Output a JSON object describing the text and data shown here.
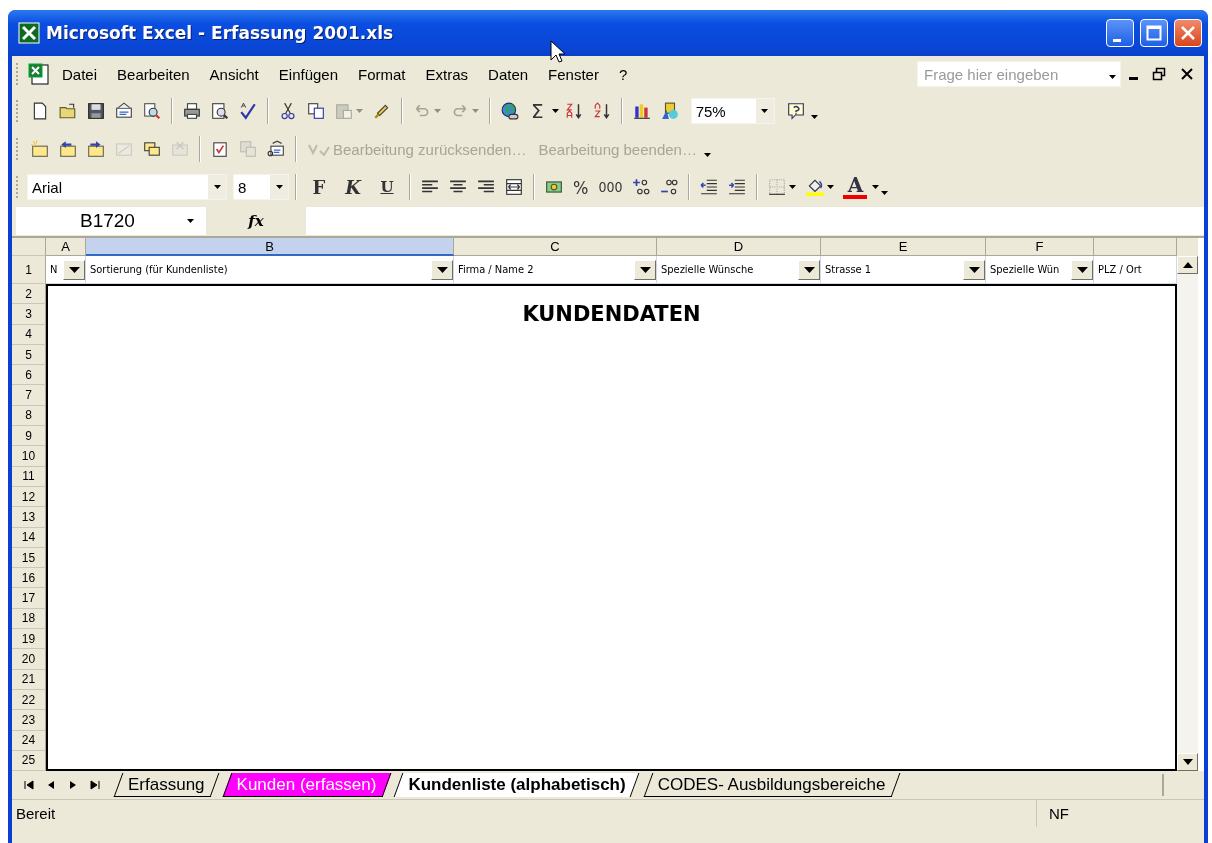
{
  "window": {
    "title": "Microsoft Excel - Erfassung 2001.xls"
  },
  "menu": [
    {
      "label": "Datei"
    },
    {
      "label": "Bearbeiten"
    },
    {
      "label": "Ansicht"
    },
    {
      "label": "Einfügen"
    },
    {
      "label": "Format"
    },
    {
      "label": "Extras"
    },
    {
      "label": "Daten"
    },
    {
      "label": "Fenster"
    },
    {
      "label": "?"
    }
  ],
  "help_search": {
    "placeholder": "Frage hier eingeben"
  },
  "standard_toolbar": {
    "sum": "Σ",
    "zoom": "75%",
    "items": [
      {
        "disabled": false
      },
      {
        "disabled": false
      },
      {
        "disabled": false
      },
      {
        "disabled": false
      },
      {
        "disabled": false
      },
      {
        "disabled": false
      },
      {
        "disabled": false
      },
      {
        "disabled": false
      },
      {
        "disabled": false
      },
      {
        "disabled": false
      },
      {
        "disabled": true
      },
      {
        "disabled": false
      },
      {
        "disabled": true
      },
      {
        "disabled": true
      },
      {
        "disabled": false
      },
      {
        "disabled": false
      },
      {
        "disabled": false
      },
      {
        "disabled": false
      },
      {
        "disabled": false
      },
      {
        "disabled": false
      }
    ]
  },
  "review_toolbar": {
    "items": [
      {
        "disabled": false
      },
      {
        "disabled": false
      },
      {
        "disabled": false
      },
      {
        "disabled": true
      },
      {
        "disabled": false
      },
      {
        "disabled": true
      },
      {
        "disabled": false
      },
      {
        "disabled": true
      },
      {
        "disabled": false
      }
    ],
    "buttons": [
      {
        "label": "Bearbeitung zurücksenden…",
        "disabled": true
      },
      {
        "label": "Bearbeitung beenden…",
        "disabled": true
      }
    ]
  },
  "formatting_toolbar": {
    "font": "Arial",
    "size": "8",
    "styles": [
      "F",
      "K",
      "U"
    ],
    "percent": "%",
    "thousands": "000",
    "font_color": "A"
  },
  "formula_bar": {
    "name_box": "B1720",
    "fx": "fx"
  },
  "sheet": {
    "columns": [
      {
        "label": "A",
        "selected": false
      },
      {
        "label": "B",
        "selected": true
      },
      {
        "label": "C",
        "selected": false
      },
      {
        "label": "D",
        "selected": false
      },
      {
        "label": "E",
        "selected": false
      },
      {
        "label": "F",
        "selected": false
      },
      {
        "selected": false
      }
    ],
    "header_row": [
      {
        "text": "N",
        "filter": true
      },
      {
        "text": "Sortierung (für Kundenliste)",
        "filter": true
      },
      {
        "text": "Firma / Name 2",
        "filter": true
      },
      {
        "text": "Spezielle Wünsche",
        "filter": true
      },
      {
        "text": "Strasse 1",
        "filter": true
      },
      {
        "text": "Spezielle Wün",
        "filter": true
      },
      {
        "text": "PLZ / Ort",
        "filter": false
      }
    ],
    "row_numbers": [
      "1",
      "2",
      "3",
      "4",
      "5",
      "6",
      "7",
      "8",
      "9",
      "10",
      "11",
      "12",
      "13",
      "14",
      "15",
      "16",
      "17",
      "18",
      "19",
      "20",
      "21",
      "22",
      "23",
      "24",
      "25"
    ],
    "title_cell": "KUNDENDATEN"
  },
  "sheet_tabs": [
    {
      "label": "Erfassung",
      "selected": false
    },
    {
      "label": "Kunden (erfassen)",
      "selected": false,
      "color": "#ff00ff"
    },
    {
      "label": "Kundenliste (alphabetisch)",
      "selected": true
    },
    {
      "label": "CODES- Ausbildungsbereiche",
      "selected": false
    }
  ],
  "status_bar": {
    "text": "Bereit",
    "indicator": "NF"
  }
}
